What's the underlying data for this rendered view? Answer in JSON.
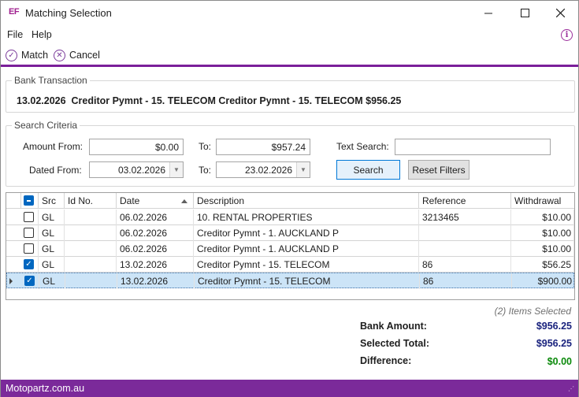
{
  "window": {
    "logo": "EF",
    "title": "Matching Selection"
  },
  "menu": {
    "file": "File",
    "help": "Help"
  },
  "toolbar": {
    "match": "Match",
    "cancel": "Cancel"
  },
  "bank_transaction": {
    "group_label": "Bank Transaction",
    "description": "13.02.2026  Creditor Pymnt - 15. TELECOM Creditor Pymnt - 15. TELECOM $956.25"
  },
  "search": {
    "group_label": "Search Criteria",
    "amount_from_label": "Amount From:",
    "amount_from": "$0.00",
    "amount_to_label": "To:",
    "amount_to": "$957.24",
    "text_search_label": "Text Search:",
    "text_search": "",
    "dated_from_label": "Dated From:",
    "dated_from": "03.02.2026",
    "dated_to_label": "To:",
    "dated_to": "23.02.2026",
    "search_button": "Search",
    "reset_button": "Reset Filters"
  },
  "grid": {
    "columns": [
      "Src",
      "Id No.",
      "Date",
      "Description",
      "Reference",
      "Withdrawal"
    ],
    "rows": [
      {
        "checked": false,
        "src": "GL",
        "id": "",
        "date": "06.02.2026",
        "description": "10. RENTAL PROPERTIES",
        "reference": "3213465",
        "withdrawal": "$10.00"
      },
      {
        "checked": false,
        "src": "GL",
        "id": "",
        "date": "06.02.2026",
        "description": "Creditor Pymnt - 1. AUCKLAND P",
        "reference": "",
        "withdrawal": "$10.00"
      },
      {
        "checked": false,
        "src": "GL",
        "id": "",
        "date": "06.02.2026",
        "description": "Creditor Pymnt - 1. AUCKLAND P",
        "reference": "",
        "withdrawal": "$10.00"
      },
      {
        "checked": true,
        "src": "GL",
        "id": "",
        "date": "13.02.2026",
        "description": "Creditor Pymnt - 15. TELECOM",
        "reference": "86",
        "withdrawal": "$56.25"
      },
      {
        "checked": true,
        "src": "GL",
        "id": "",
        "date": "13.02.2026",
        "description": "Creditor Pymnt - 15. TELECOM",
        "reference": "86",
        "withdrawal": "$900.00",
        "selected": true
      }
    ]
  },
  "summary": {
    "items_selected": "(2) Items Selected",
    "bank_amount_label": "Bank Amount:",
    "bank_amount": "$956.25",
    "selected_total_label": "Selected Total:",
    "selected_total": "$956.25",
    "difference_label": "Difference:",
    "difference": "$0.00"
  },
  "status": {
    "company": "Motopartz.com.au"
  },
  "colors": {
    "accent": "#7b1f9a",
    "status_bar": "#7b2a9a",
    "total_blue": "#1a237e",
    "difference_green": "#0b8a0b",
    "selection": "#cce4f7"
  }
}
